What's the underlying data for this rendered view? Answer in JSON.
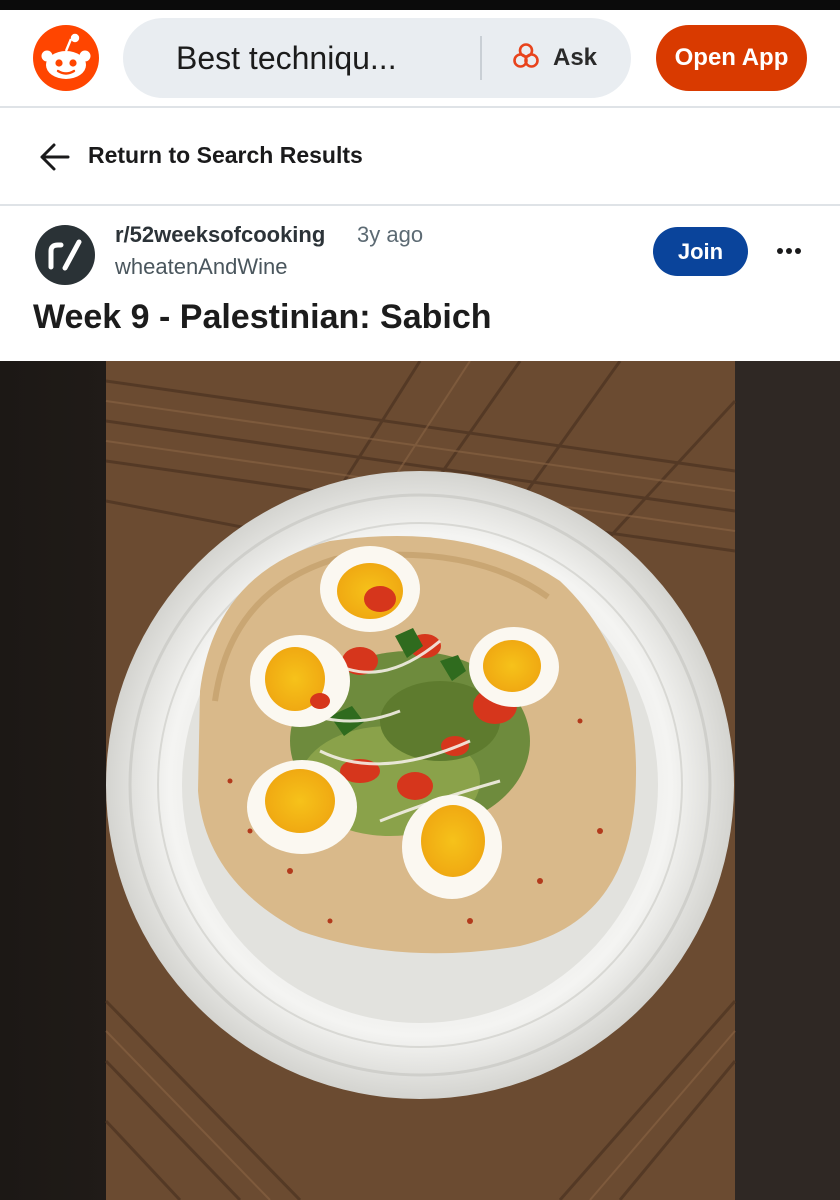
{
  "header": {
    "logo_icon": "reddit-snoo-icon",
    "search_text": "Best techniqu...",
    "ask_icon": "reddit-answers-icon",
    "ask_label": "Ask",
    "open_app_label": "Open App",
    "accent_color": "#d93a00"
  },
  "nav": {
    "back_icon": "arrow-left-icon",
    "back_label": "Return to Search Results"
  },
  "post": {
    "subreddit": "r/52weeksofcooking",
    "time_ago": "3y ago",
    "author": "wheatenAndWine",
    "join_label": "Join",
    "join_color": "#0a449b",
    "more_icon": "more-options-icon",
    "title": "Week 9 - Palestinian: Sabich",
    "image_icon": "post-photo"
  }
}
